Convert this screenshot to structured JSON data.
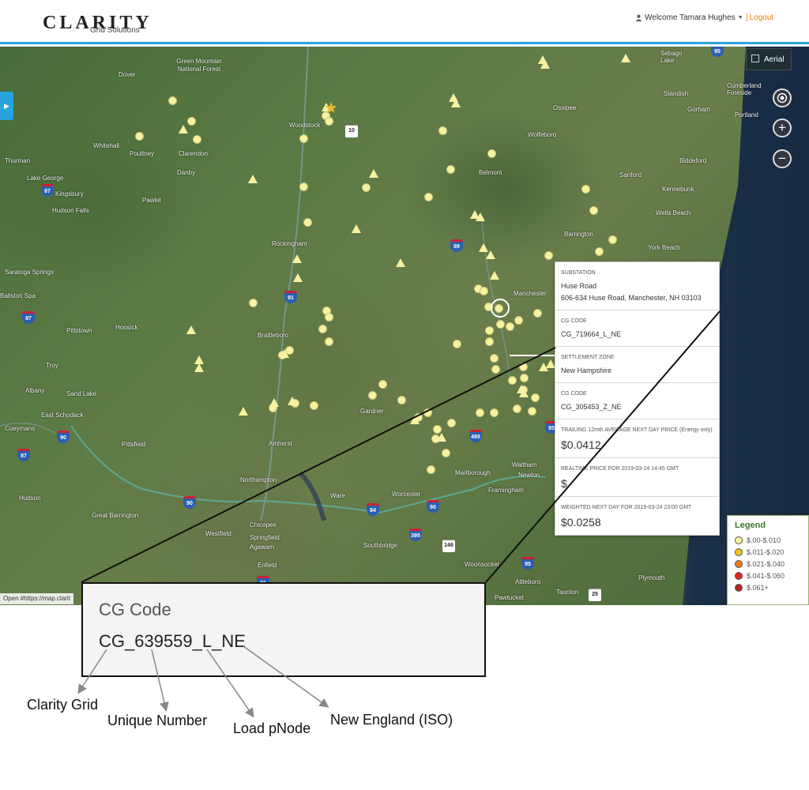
{
  "header": {
    "logo_text": "CLARITY",
    "logo_subtext": "Grid Solutions",
    "welcome_text": "Welcome Tamara Hughes",
    "logout_label": "Logout"
  },
  "map": {
    "aerial_label": "Aerial",
    "attribution": "Open #https://map.clarit",
    "labels": [
      {
        "text": "Green Mountain National Forest"
      },
      {
        "text": "Woodstock"
      },
      {
        "text": "Whitehall"
      },
      {
        "text": "Poultney"
      },
      {
        "text": "Clarendon"
      },
      {
        "text": "Thurman"
      },
      {
        "text": "Lake George"
      },
      {
        "text": "Kingsbury"
      },
      {
        "text": "Danby"
      },
      {
        "text": "Pawlet"
      },
      {
        "text": "Hudson Falls"
      },
      {
        "text": "Saratoga Springs"
      },
      {
        "text": "Ballston Spa"
      },
      {
        "text": "Pittstown"
      },
      {
        "text": "Hoosick"
      },
      {
        "text": "Troy"
      },
      {
        "text": "Albany"
      },
      {
        "text": "Sand Lake"
      },
      {
        "text": "East Schodack"
      },
      {
        "text": "Coeymans"
      },
      {
        "text": "Pittsfield"
      },
      {
        "text": "Hudson"
      },
      {
        "text": "Great Barrington"
      },
      {
        "text": "Westfield"
      },
      {
        "text": "Chicopee"
      },
      {
        "text": "Springfield"
      },
      {
        "text": "Agawam"
      },
      {
        "text": "Enfield"
      },
      {
        "text": "Amherst"
      },
      {
        "text": "Northampton"
      },
      {
        "text": "Ware"
      },
      {
        "text": "Brattleboro"
      },
      {
        "text": "Rockingham"
      },
      {
        "text": "Gardner"
      },
      {
        "text": "Worcester"
      },
      {
        "text": "Southbridge"
      },
      {
        "text": "Marlborough"
      },
      {
        "text": "Framingham"
      },
      {
        "text": "Waltham"
      },
      {
        "text": "Newton"
      },
      {
        "text": "Woonsocket"
      },
      {
        "text": "Attleboro"
      },
      {
        "text": "Pawtucket"
      },
      {
        "text": "Taunton"
      },
      {
        "text": "Plymouth"
      },
      {
        "text": "Belmont"
      },
      {
        "text": "Wolfeboro"
      },
      {
        "text": "Ossipee"
      },
      {
        "text": "Sanford"
      },
      {
        "text": "Barrington"
      },
      {
        "text": "York Beach"
      },
      {
        "text": "Biddeford"
      },
      {
        "text": "Kennebunk"
      },
      {
        "text": "Wells Beach"
      },
      {
        "text": "Standish"
      },
      {
        "text": "Gorham"
      },
      {
        "text": "Portland"
      },
      {
        "text": "Cumberland Foreside"
      },
      {
        "text": "Manchester"
      },
      {
        "text": "Sebago Lake"
      },
      {
        "text": "Dover"
      }
    ],
    "shields": [
      {
        "num": "87"
      },
      {
        "num": "87"
      },
      {
        "num": "87"
      },
      {
        "num": "91"
      },
      {
        "num": "89"
      },
      {
        "num": "90"
      },
      {
        "num": "90"
      },
      {
        "num": "90"
      },
      {
        "num": "84"
      },
      {
        "num": "395"
      },
      {
        "num": "495"
      },
      {
        "num": "95"
      },
      {
        "num": "95"
      },
      {
        "num": "91"
      },
      {
        "num": "146"
      },
      {
        "num": "10"
      },
      {
        "num": "25"
      },
      {
        "num": "95"
      }
    ]
  },
  "info_panel": {
    "substation_label": "SUBSTATION",
    "substation_name": "Huse Road",
    "substation_address": "606-634 Huse Road, Manchester, NH 03103",
    "cg_code_label_1": "CG CODE",
    "cg_code_1": "CG_719664_L_NE",
    "settlement_zone_label": "SETTLEMENT ZONE",
    "settlement_zone": "New Hampshire",
    "cg_code_label_2": "CG CODE",
    "cg_code_2": "CG_305453_Z_NE",
    "trailing_label": "TRAILING 12mth AVERAGE NEXT DAY PRICE (Energy only)",
    "trailing_price": "$0.0412",
    "realtime_label": "REALTIME PRICE FOR 2019-03-24 14:45 GMT",
    "realtime_price": "$",
    "weighted_label": "WEIGHTED NEXT DAY FOR 2019-03-24 23:00 GMT",
    "weighted_price": "$0.0258"
  },
  "legend": {
    "title": "Legend",
    "items": [
      {
        "label": "$.00-$.010",
        "color": "#f6f2a0"
      },
      {
        "label": "$.011-$.020",
        "color": "#f2c21b"
      },
      {
        "label": "$.021-$.040",
        "color": "#e87a1c"
      },
      {
        "label": "$.041-$.060",
        "color": "#e02222"
      },
      {
        "label": "$.061+",
        "color": "#b5281e"
      }
    ]
  },
  "callout": {
    "title": "CG Code",
    "code": "CG_639559_L_NE"
  },
  "annotations": {
    "clarity_grid": "Clarity Grid",
    "unique_number": "Unique Number",
    "load_pnode": "Load pNode",
    "new_england": "New England (ISO)"
  },
  "colors": {
    "accent": "#29a3dc",
    "logout": "#e8820c",
    "marker": "#f6f2a0",
    "legend_title": "#3a7a2a"
  }
}
